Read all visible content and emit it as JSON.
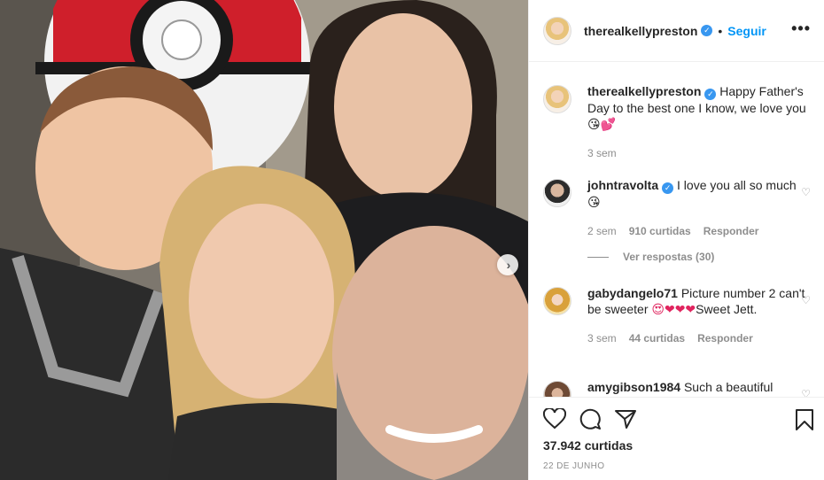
{
  "header": {
    "username": "therealkellypreston",
    "separator": "•",
    "follow_label": "Seguir",
    "more_label": "•••"
  },
  "caption": {
    "username": "therealkellypreston",
    "text": "Happy Father's Day to the best one I know, we love you",
    "emoji": "😘💕",
    "time": "3 sem"
  },
  "comments": [
    {
      "username": "johntravolta",
      "text": "I love you all so much",
      "emoji": "😘",
      "time": "2 sem",
      "likes": "910 curtidas",
      "reply_label": "Responder",
      "verified": true
    },
    {
      "username": "gabydangelo71",
      "text": "Picture number 2 can't be sweeter",
      "emoji": "😍❤❤❤",
      "text_after": "Sweet Jett.",
      "time": "3 sem",
      "likes": "44 curtidas",
      "reply_label": "Responder",
      "verified": false
    },
    {
      "username": "amygibson1984",
      "text": "Such a beautiful",
      "verified": false
    }
  ],
  "view_replies": "Ver respostas (30)",
  "stats": {
    "likes": "37.942 curtidas",
    "date": "22 DE JUNHO"
  },
  "icons": [
    "heart-icon",
    "comment-icon",
    "share-icon",
    "bookmark-icon",
    "verified-badge-icon",
    "next-arrow-icon"
  ],
  "colors": {
    "accent": "#0095f6",
    "verified": "#3897f0",
    "muted": "#8e8e8e",
    "text": "#262626"
  }
}
